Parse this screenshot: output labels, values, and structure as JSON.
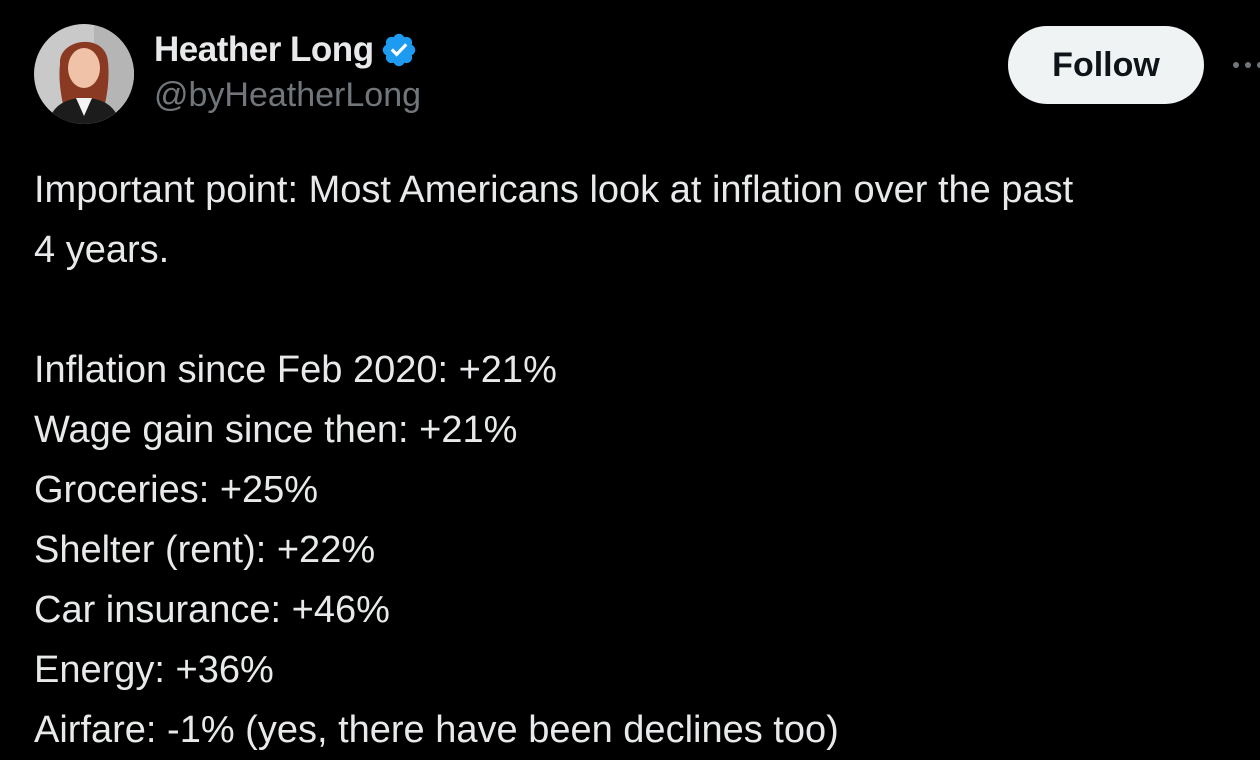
{
  "author": {
    "display_name": "Heather Long",
    "handle": "@byHeatherLong",
    "verified_color": "#1d9bf0"
  },
  "actions": {
    "follow_label": "Follow",
    "more_icon": "more-icon"
  },
  "tweet": {
    "intro_line1": "Important point: Most Americans look at inflation over the past",
    "intro_line2": "4 years.",
    "stats": [
      "Inflation since Feb 2020: +21%",
      "Wage gain since then: +21%",
      "Groceries: +25%",
      "Shelter (rent): +22%",
      "Car insurance: +46%",
      "Energy: +36%",
      "Airfare: -1% (yes, there have been declines too)"
    ]
  },
  "colors": {
    "background": "#000000",
    "text_primary": "#e7e9ea",
    "text_secondary": "#71767b",
    "button_bg": "#eff3f4",
    "button_text": "#0f1419"
  }
}
